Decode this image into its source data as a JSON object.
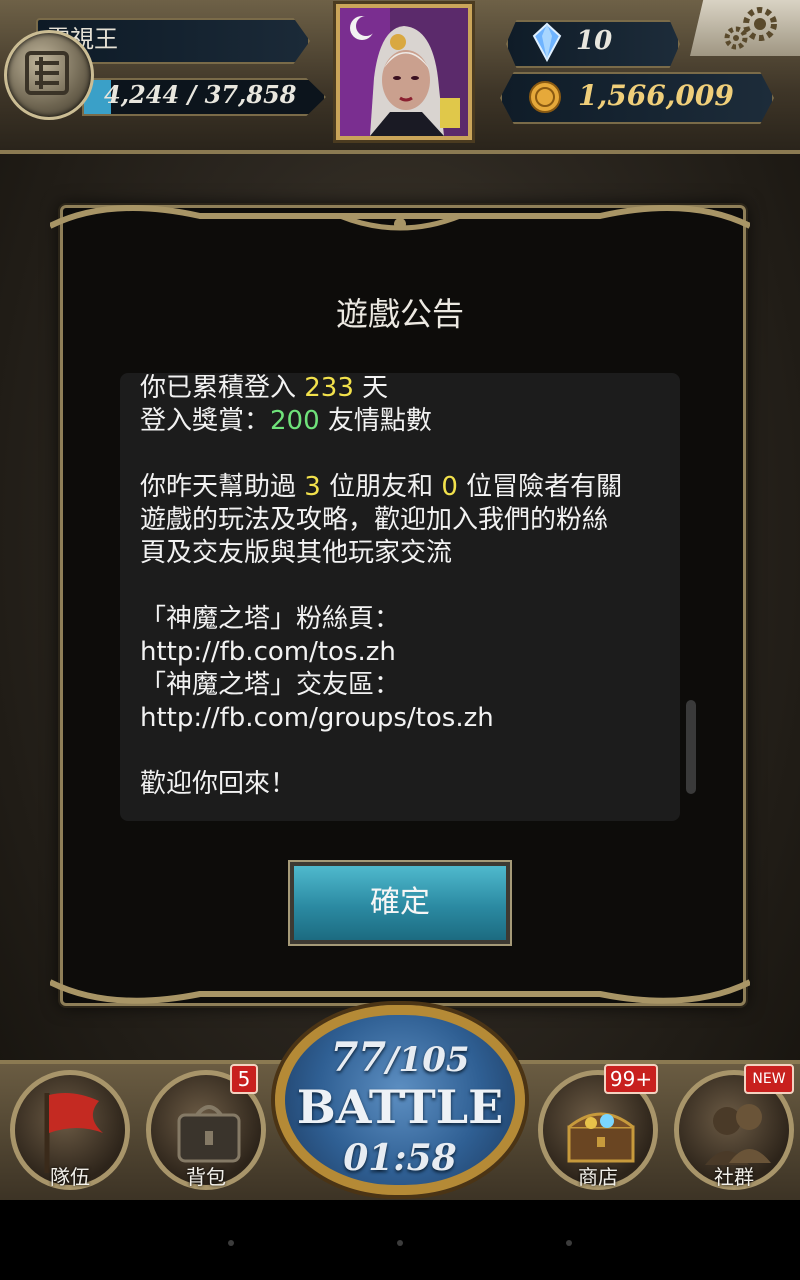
{
  "header": {
    "player_name": "電視王",
    "hp_text": "4,244 / 37,858",
    "hp_fraction": 0.112,
    "gems": "10",
    "coins": "1,566,009"
  },
  "dialog": {
    "title": "遊戲公告",
    "confirm_label": "確定",
    "lines": [
      {
        "parts": [
          {
            "t": "你已累積登入 "
          },
          {
            "t": "233",
            "c": "y"
          },
          {
            "t": " 天"
          }
        ]
      },
      {
        "parts": [
          {
            "t": "登入獎賞："
          },
          {
            "t": "200",
            "c": "g"
          },
          {
            "t": " 友情點數"
          }
        ]
      },
      {
        "parts": []
      },
      {
        "parts": [
          {
            "t": "你昨天幫助過 "
          },
          {
            "t": "3",
            "c": "y"
          },
          {
            "t": " 位朋友和 "
          },
          {
            "t": "0",
            "c": "y"
          },
          {
            "t": " 位冒險者有關"
          }
        ]
      },
      {
        "parts": [
          {
            "t": "遊戲的玩法及攻略，歡迎加入我們的粉絲"
          }
        ]
      },
      {
        "parts": [
          {
            "t": "頁及交友版與其他玩家交流"
          }
        ]
      },
      {
        "parts": []
      },
      {
        "parts": [
          {
            "t": "「神魔之塔」粉絲頁："
          }
        ]
      },
      {
        "parts": [
          {
            "t": " http://fb.com/tos.zh"
          }
        ]
      },
      {
        "parts": [
          {
            "t": "「神魔之塔」交友區："
          }
        ]
      },
      {
        "parts": [
          {
            "t": "http://fb.com/groups/tos.zh"
          }
        ]
      },
      {
        "parts": []
      },
      {
        "parts": [
          {
            "t": "歡迎你回來！"
          }
        ]
      }
    ]
  },
  "bottom_nav": {
    "team_label": "隊伍",
    "bag_label": "背包",
    "bag_badge": "5",
    "shop_label": "商店",
    "shop_badge": "99+",
    "social_label": "社群",
    "social_badge": "NEW",
    "battle": {
      "stamina_current": "77",
      "stamina_max": "/105",
      "label": "BATTLE",
      "timer": "01:58"
    }
  }
}
